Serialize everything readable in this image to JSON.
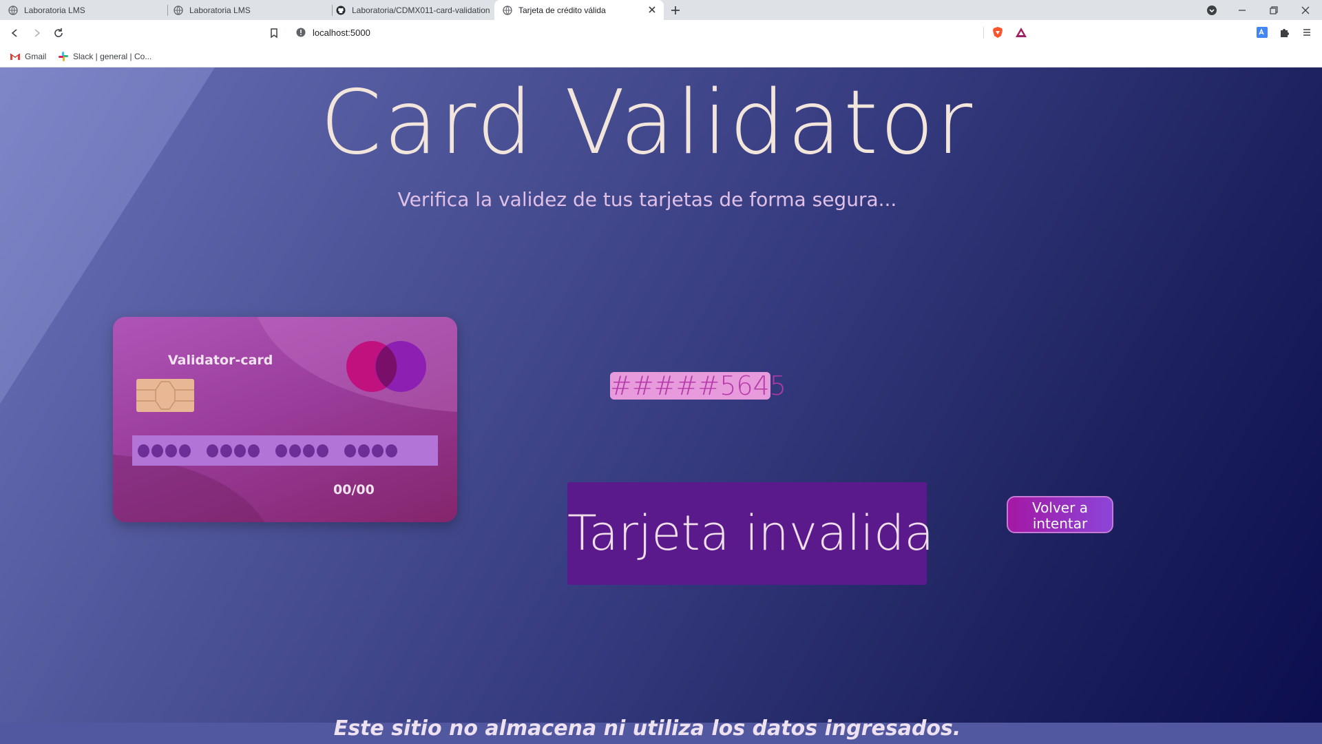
{
  "browser": {
    "tabs": [
      {
        "title": "Laboratoria LMS",
        "icon": "globe-icon",
        "active": false
      },
      {
        "title": "Laboratoria LMS",
        "icon": "globe-icon",
        "active": false
      },
      {
        "title": "Laboratoria/CDMX011-card-validation",
        "icon": "github-icon",
        "active": false
      },
      {
        "title": "Tarjeta de crédito válida",
        "icon": "globe-icon",
        "active": true
      }
    ],
    "address": {
      "url": "localhost:5000"
    },
    "bookmarks": [
      {
        "label": "Gmail",
        "icon": "gmail-icon"
      },
      {
        "label": "Slack | general | Co...",
        "icon": "slack-icon"
      }
    ]
  },
  "page": {
    "title": "Card Validator",
    "subtitle": "Verifica la validez de tus tarjetas de forma segura...",
    "card": {
      "brand": "Validator-card",
      "expiry": "00/00",
      "number_groups": 4
    },
    "masked_number": "#####5645",
    "result": "Tarjeta invalida",
    "retry_button": "Volver a intentar",
    "footer": "Este sitio no almacena ni utiliza los datos ingresados."
  },
  "colors": {
    "background_start": "#6c72b8",
    "background_end": "#0b0d4e",
    "title": "#f2e6dc",
    "result_box": "#5a1a8c",
    "masked_field": "#e79bdd"
  }
}
